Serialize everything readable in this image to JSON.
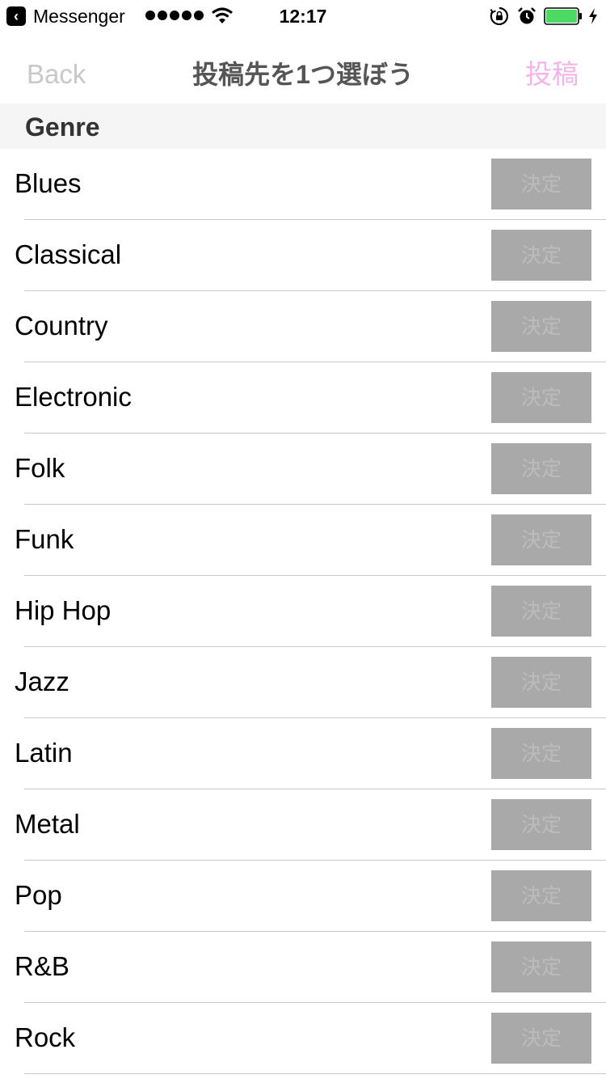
{
  "status_bar": {
    "back_app": "Messenger",
    "time": "12:17",
    "signal_dots": 5,
    "battery_level": 1.0,
    "charging": true
  },
  "nav": {
    "back_label": "Back",
    "title": "投稿先を1つ選ぼう",
    "post_label": "投稿"
  },
  "section": {
    "title": "Genre"
  },
  "genres": [
    {
      "label": "Blues",
      "button": "決定"
    },
    {
      "label": "Classical",
      "button": "決定"
    },
    {
      "label": "Country",
      "button": "決定"
    },
    {
      "label": "Electronic",
      "button": "決定"
    },
    {
      "label": "Folk",
      "button": "決定"
    },
    {
      "label": "Funk",
      "button": "決定"
    },
    {
      "label": "Hip Hop",
      "button": "決定"
    },
    {
      "label": "Jazz",
      "button": "決定"
    },
    {
      "label": "Latin",
      "button": "決定"
    },
    {
      "label": "Metal",
      "button": "決定"
    },
    {
      "label": "Pop",
      "button": "決定"
    },
    {
      "label": "R&B",
      "button": "決定"
    },
    {
      "label": "Rock",
      "button": "決定"
    }
  ],
  "colors": {
    "nav_back": "#c7c7cc",
    "nav_title": "#555555",
    "nav_post": "#f4b4ea",
    "section_bg": "#f5f5f5",
    "button_bg": "#a9a9a9",
    "button_text": "#bcbcbc",
    "battery_fill": "#4cd964"
  },
  "icons": {
    "back_badge": "chevron-left-icon",
    "wifi": "wifi-icon",
    "lock": "orientation-lock-icon",
    "alarm": "alarm-clock-icon",
    "battery": "battery-icon",
    "bolt": "charging-bolt-icon"
  }
}
